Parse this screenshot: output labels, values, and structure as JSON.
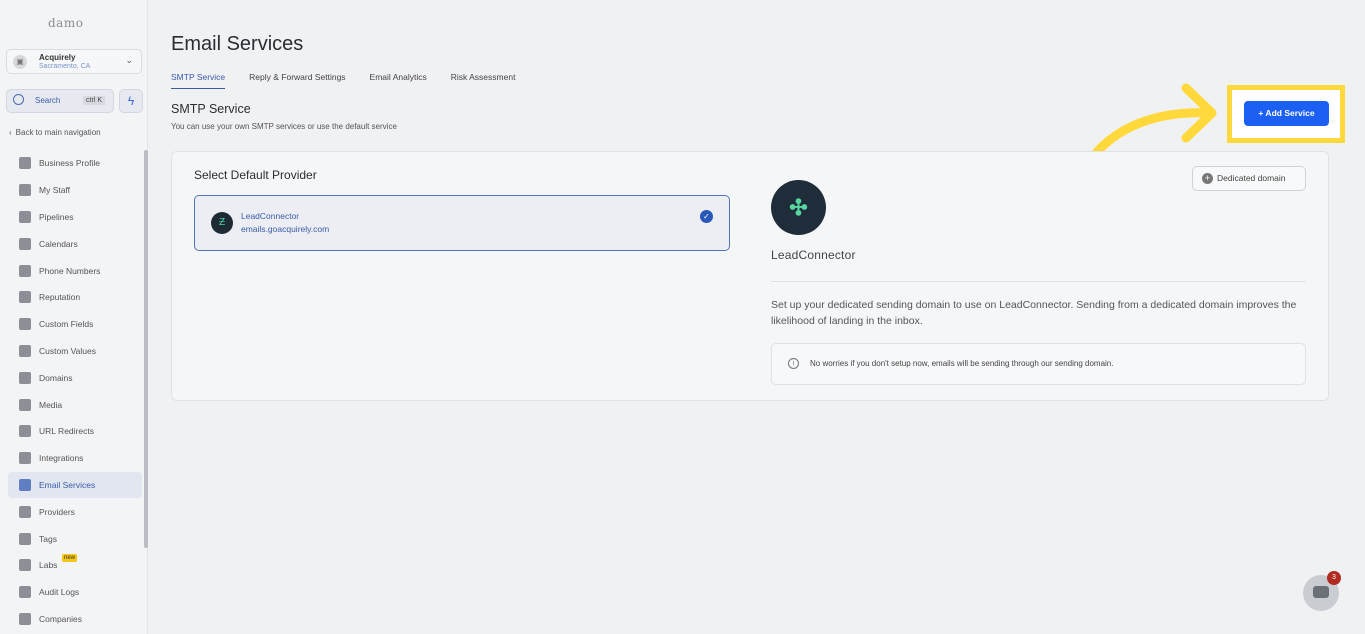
{
  "sidebar": {
    "logo": "damo",
    "account": {
      "name": "Acquirely",
      "location": "Sacramento, CA"
    },
    "search": {
      "label": "Search",
      "shortcut": "ctrl K"
    },
    "back_label": "Back to main navigation",
    "items": [
      {
        "label": "Business Profile"
      },
      {
        "label": "My Staff"
      },
      {
        "label": "Pipelines"
      },
      {
        "label": "Calendars"
      },
      {
        "label": "Phone Numbers"
      },
      {
        "label": "Reputation"
      },
      {
        "label": "Custom Fields"
      },
      {
        "label": "Custom Values"
      },
      {
        "label": "Domains"
      },
      {
        "label": "Media"
      },
      {
        "label": "URL Redirects"
      },
      {
        "label": "Integrations"
      },
      {
        "label": "Email Services",
        "active": true
      },
      {
        "label": "Providers"
      },
      {
        "label": "Tags"
      },
      {
        "label": "Labs",
        "badge": "new"
      },
      {
        "label": "Audit Logs"
      },
      {
        "label": "Companies"
      }
    ]
  },
  "page": {
    "title": "Email Services",
    "tabs": [
      {
        "label": "SMTP Service",
        "active": true
      },
      {
        "label": "Reply & Forward Settings"
      },
      {
        "label": "Email Analytics"
      },
      {
        "label": "Risk Assessment"
      }
    ],
    "section_title": "SMTP Service",
    "section_subtitle": "You can use your own SMTP services or use the default service",
    "add_service_label": "+ Add Service"
  },
  "card": {
    "label": "Select Default Provider",
    "provider": {
      "name": "LeadConnector",
      "domain": "emails.goacquirely.com"
    },
    "dedicated_domain_label": "Dedicated domain",
    "detail_name": "LeadConnector",
    "description": "Set up your dedicated sending domain to use on LeadConnector. Sending from a dedicated domain improves the likelihood of landing in the inbox.",
    "info": "No worries if you don't setup now, emails will be sending through our sending domain."
  },
  "chat": {
    "badge_count": "3"
  },
  "colors": {
    "accent": "#1c5ff3",
    "highlight": "#ffd93b"
  }
}
